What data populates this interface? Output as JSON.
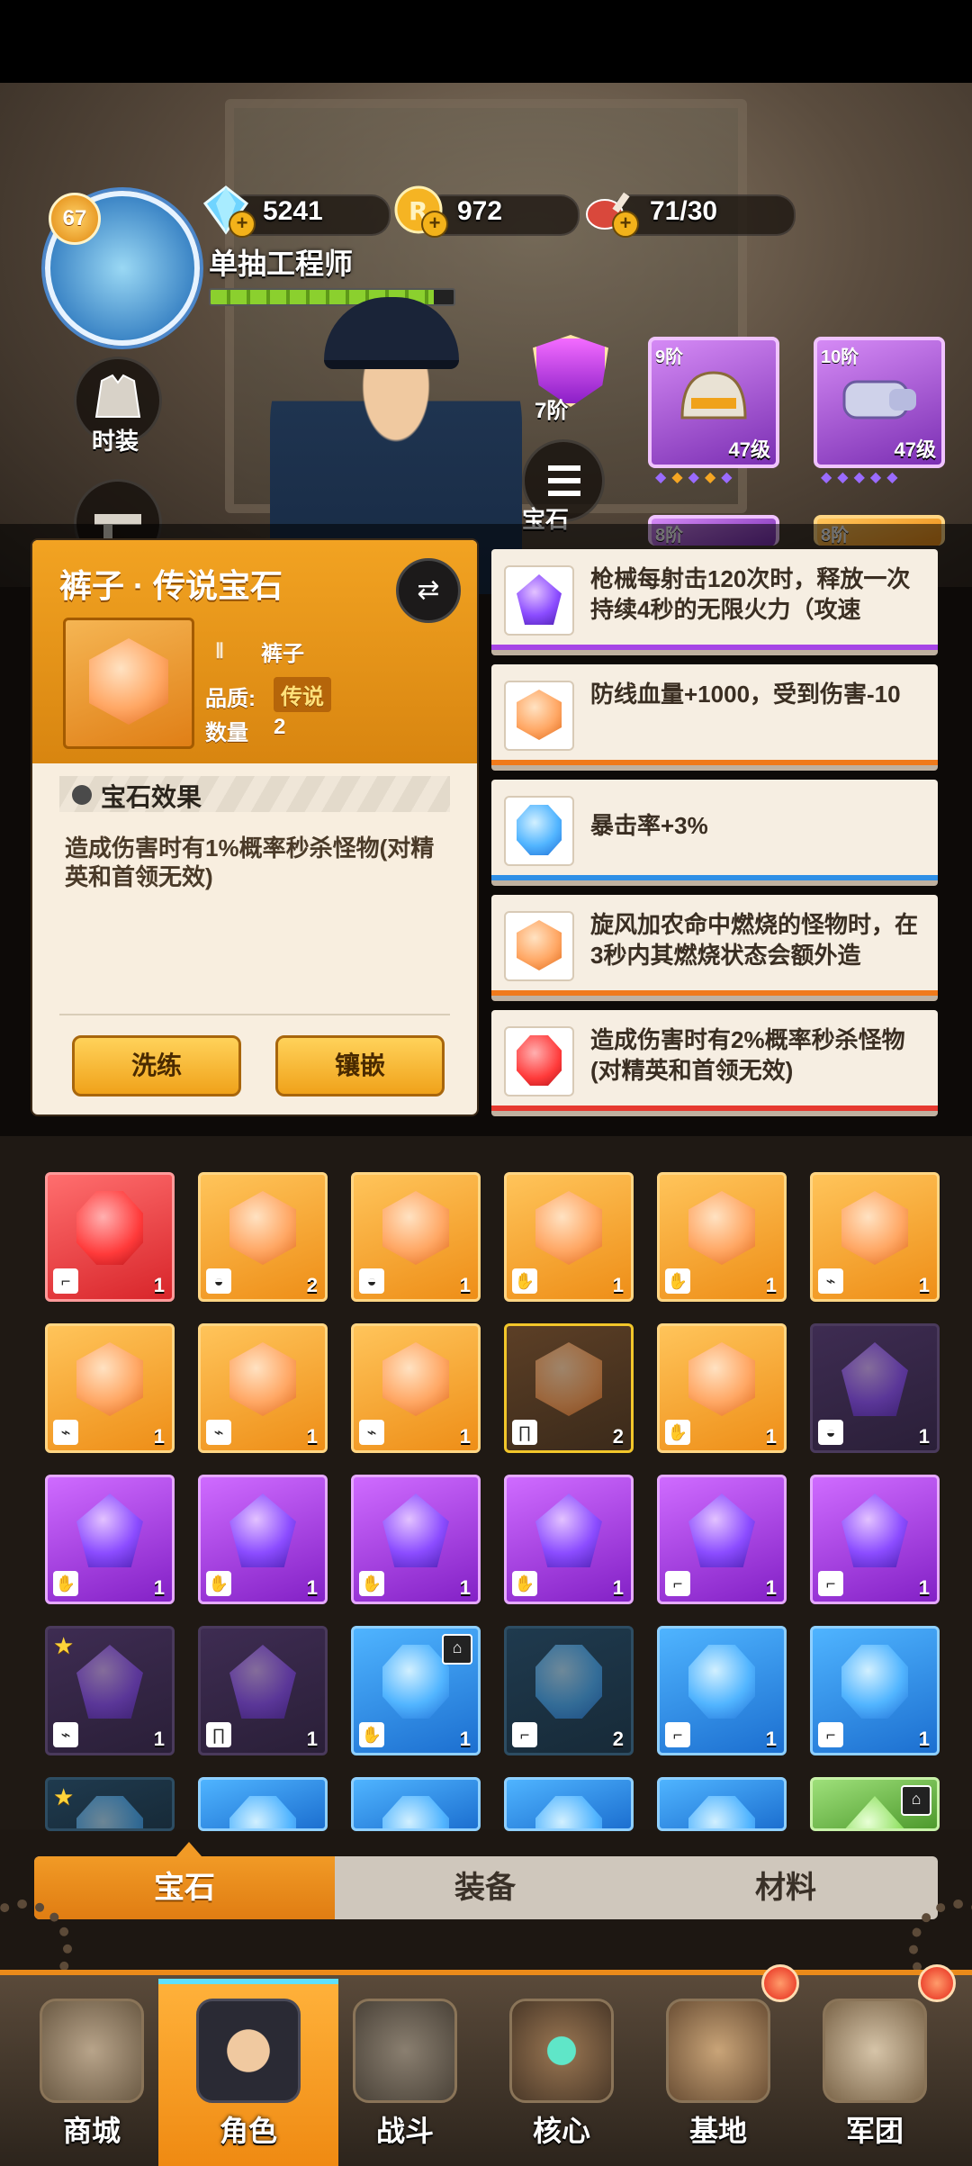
{
  "header": {
    "level": "67",
    "player_name": "单抽工程师",
    "xp_fraction": 0.92,
    "resources": [
      {
        "icon": "diamond-icon",
        "value": "5241"
      },
      {
        "icon": "gold-coin-icon",
        "value": "972"
      },
      {
        "icon": "meat-stamina-icon",
        "value": "71/30"
      }
    ]
  },
  "side_buttons": {
    "costume_label": "时装"
  },
  "equipment": {
    "rank_label": "7阶",
    "cards": [
      {
        "tier": "9阶",
        "level": "47级"
      },
      {
        "tier": "10阶",
        "level": "47级"
      }
    ],
    "row2_tiers": [
      "8阶",
      "8阶"
    ],
    "gem_button_label": "宝石"
  },
  "gem_detail": {
    "title": "裤子 · 传说宝石",
    "slot_label": "裤子",
    "quality_label": "品质:",
    "quality_value": "传说",
    "quantity_label": "数量",
    "quantity_value": "2",
    "effect_title": "宝石效果",
    "effect_text": "造成伤害时有1%概率秒杀怪物(对精英和首领无效)",
    "reroll_label": "洗练",
    "inlay_label": "镶嵌"
  },
  "set_bonuses": [
    {
      "color": "purple",
      "text": "枪械每射击120次时，释放一次持续4秒的无限火力（攻速"
    },
    {
      "color": "orange",
      "text": "防线血量+1000，受到伤害-10"
    },
    {
      "color": "blue",
      "text": "暴击率+3%"
    },
    {
      "color": "orange",
      "text": "旋风加农命中燃烧的怪物时，在3秒内其燃烧状态会额外造"
    },
    {
      "color": "red",
      "text": "造成伤害时有2%概率秒杀怪物(对精英和首领无效)"
    }
  ],
  "gem_grid": [
    [
      {
        "color": "red",
        "slot": "boot",
        "count": "1"
      },
      {
        "color": "orange",
        "slot": "helmet",
        "count": "2"
      },
      {
        "color": "orange",
        "slot": "helmet",
        "count": "1"
      },
      {
        "color": "orange",
        "slot": "glove",
        "count": "1"
      },
      {
        "color": "orange",
        "slot": "glove",
        "count": "1"
      },
      {
        "color": "orange",
        "slot": "gun",
        "count": "1"
      }
    ],
    [
      {
        "color": "orange",
        "slot": "gun",
        "count": "1"
      },
      {
        "color": "orange",
        "slot": "gun",
        "count": "1"
      },
      {
        "color": "orange",
        "slot": "gun",
        "count": "1"
      },
      {
        "color": "dimorange",
        "slot": "pants",
        "count": "2"
      },
      {
        "color": "orange",
        "slot": "hand",
        "count": "1"
      },
      {
        "color": "dimpurple",
        "slot": "helmet",
        "count": "1"
      }
    ],
    [
      {
        "color": "purple",
        "slot": "glove",
        "count": "1"
      },
      {
        "color": "purple",
        "slot": "glove",
        "count": "1"
      },
      {
        "color": "purple",
        "slot": "glove",
        "count": "1"
      },
      {
        "color": "purple",
        "slot": "glove",
        "count": "1"
      },
      {
        "color": "purple",
        "slot": "boot",
        "count": "1"
      },
      {
        "color": "purple",
        "slot": "boot",
        "count": "1"
      }
    ],
    [
      {
        "color": "dimpurple",
        "slot": "gun",
        "count": "1",
        "star": true
      },
      {
        "color": "dimpurple",
        "slot": "pants",
        "count": "1"
      },
      {
        "color": "blue",
        "slot": "glove",
        "count": "1",
        "lock": true
      },
      {
        "color": "dimblue",
        "slot": "boot",
        "count": "2"
      },
      {
        "color": "blue",
        "slot": "boot",
        "count": "1"
      },
      {
        "color": "blue",
        "slot": "boot",
        "count": "1"
      }
    ],
    [
      {
        "color": "dimblue",
        "slot": "",
        "count": "",
        "star": true
      },
      {
        "color": "blue",
        "slot": "",
        "count": ""
      },
      {
        "color": "blue",
        "slot": "",
        "count": ""
      },
      {
        "color": "blue",
        "slot": "",
        "count": ""
      },
      {
        "color": "blue",
        "slot": "",
        "count": ""
      },
      {
        "color": "green",
        "slot": "",
        "count": "",
        "lock": true
      }
    ]
  ],
  "tabs": [
    {
      "label": "宝石",
      "active": true
    },
    {
      "label": "装备",
      "active": false
    },
    {
      "label": "材料",
      "active": false
    }
  ],
  "nav": [
    {
      "label": "商城",
      "icon": "shop-icon"
    },
    {
      "label": "角色",
      "icon": "character-icon",
      "active": true
    },
    {
      "label": "战斗",
      "icon": "battle-pistols-icon"
    },
    {
      "label": "核心",
      "icon": "core-emblem-icon"
    },
    {
      "label": "基地",
      "icon": "base-tower-icon",
      "badge": true
    },
    {
      "label": "军团",
      "icon": "legion-shield-icon",
      "badge": true
    }
  ],
  "colors": {
    "accent_orange": "#f19a26",
    "nav_border": "#ea8a1a",
    "panel_bg": "#f8eedf"
  }
}
